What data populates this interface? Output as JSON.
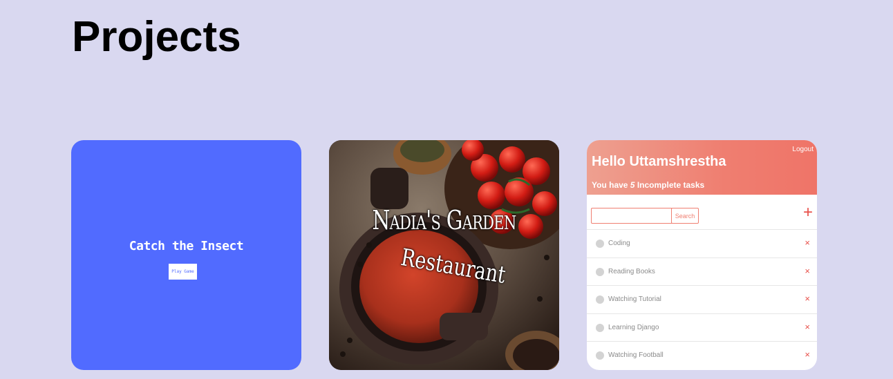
{
  "page": {
    "title": "Projects"
  },
  "projects": {
    "insect": {
      "title": "Catch the Insect",
      "button_label": "Play Game",
      "color": "#516bff"
    },
    "garden": {
      "title": "Nadia's Garden",
      "subtitle": "Restaurant"
    },
    "todo": {
      "logout_label": "Logout",
      "greeting": "Hello Uttamshrestha",
      "count_prefix": "You have ",
      "count_value": "5",
      "count_suffix": " Incomplete tasks",
      "search_label": "Search",
      "search_value": "",
      "add_icon": "+",
      "delete_icon": "×",
      "accent_color": "#ef7e70",
      "tasks": [
        {
          "label": "Coding"
        },
        {
          "label": "Reading Books"
        },
        {
          "label": "Watching Tutorial"
        },
        {
          "label": "Learning Django"
        },
        {
          "label": "Watching Football"
        }
      ]
    }
  }
}
